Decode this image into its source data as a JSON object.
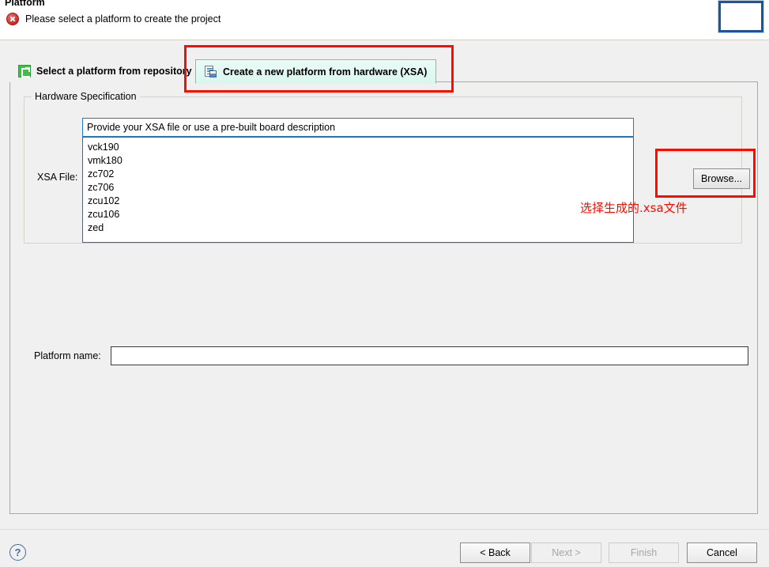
{
  "window": {
    "title": "Platform"
  },
  "status": {
    "icon": "error-icon",
    "message": "Please select a platform to create the project"
  },
  "tabs": [
    {
      "id": "select-from-repository",
      "label": "Select a platform from repository",
      "icon": "repository-icon",
      "active": false
    },
    {
      "id": "create-new-from-hardware",
      "label": "Create a new platform from hardware (XSA)",
      "icon": "new-platform-icon",
      "active": true
    }
  ],
  "hardware_specification": {
    "group_title": "Hardware Specification",
    "xsa_file_label": "XSA File:",
    "combo_value": "Provide your XSA file or use a pre-built board description",
    "combo_placeholder": "Provide your XSA file or use a pre-built board description",
    "dropdown_options": [
      "vck190",
      "vmk180",
      "zc702",
      "zc706",
      "zcu102",
      "zcu106",
      "zed"
    ],
    "browse_label": "Browse..."
  },
  "platform_name": {
    "label": "Platform name:",
    "value": "",
    "placeholder": ""
  },
  "annotations": {
    "xsa_note": "选择生成的.xsa文件",
    "highlight_color": "#fb0b00"
  },
  "footer": {
    "help_icon": "help-icon",
    "buttons": [
      {
        "id": "back",
        "label": "< Back",
        "enabled": true
      },
      {
        "id": "next",
        "label": "Next >",
        "enabled": false
      },
      {
        "id": "finish",
        "label": "Finish",
        "enabled": false
      },
      {
        "id": "cancel",
        "label": "Cancel",
        "enabled": true
      }
    ]
  },
  "colors": {
    "dialog_background": "#f0f0f0",
    "active_tab_background": "#d9f7ee",
    "focus_border": "#1e7bc4",
    "error_red": "#cf2b23",
    "annotation_red": "#fb0b00",
    "thumbnail_border": "#1f5596"
  }
}
